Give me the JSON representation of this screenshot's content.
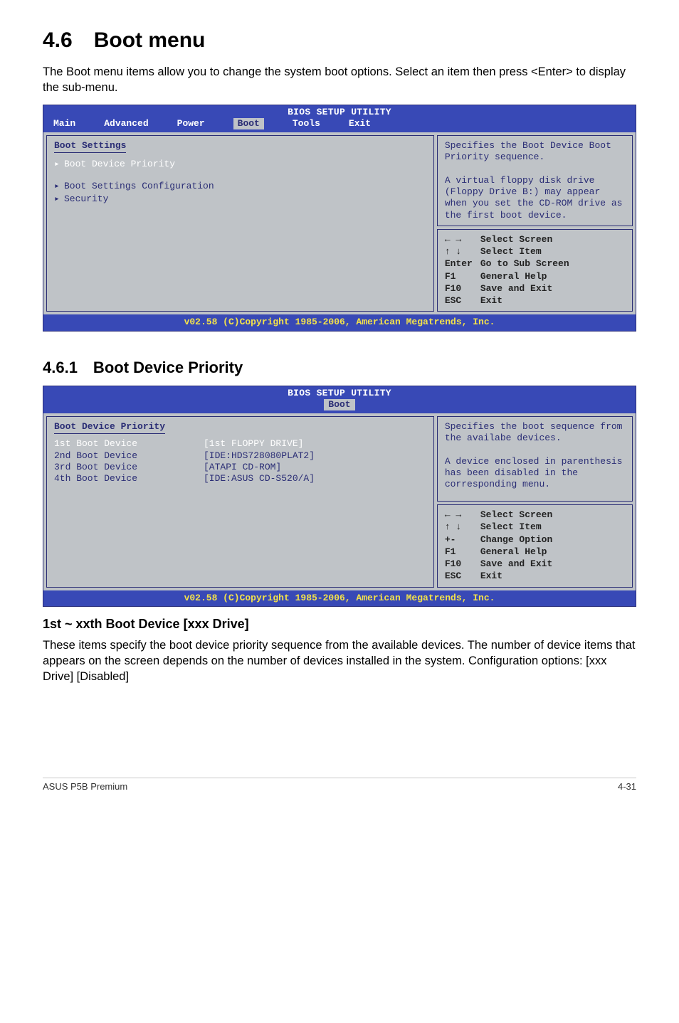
{
  "section": {
    "number_title": "4.6 Boot menu",
    "intro": "The Boot menu items allow you to change the system boot options. Select an item then press <Enter> to display the sub-menu."
  },
  "bios1": {
    "title": "BIOS SETUP UTILITY",
    "menus": {
      "m0": "Main",
      "m1": "Advanced",
      "m2": "Power",
      "m3": "Boot",
      "m4": "Tools",
      "m5": "Exit"
    },
    "left": {
      "heading": "Boot Settings",
      "items": {
        "i0": "Boot Device Priority",
        "i1": "Boot Settings Configuration",
        "i2": "Security"
      }
    },
    "help_top": "Specifies the Boot Device Boot Priority sequence.\n\nA virtual floppy disk drive (Floppy Drive B:) may appear when you set the CD-ROM drive as the first boot device.",
    "nav": {
      "l0": "Select Screen",
      "l1": "Select Item",
      "k2": "Enter",
      "l2": "Go to Sub Screen",
      "k3": "F1",
      "l3": "General Help",
      "k4": "F10",
      "l4": "Save and Exit",
      "k5": "ESC",
      "l5": "Exit"
    },
    "footer": "v02.58 (C)Copyright 1985-2006, American Megatrends, Inc."
  },
  "subsection": {
    "number_title": "4.6.1 Boot Device Priority"
  },
  "bios2": {
    "title": "BIOS SETUP UTILITY",
    "menu_active": "Boot",
    "left": {
      "heading": "Boot Device Priority",
      "rows": {
        "r0k": "1st Boot Device",
        "r0v": "[1st FLOPPY DRIVE]",
        "r1k": "2nd Boot Device",
        "r1v": "[IDE:HDS728080PLAT2]",
        "r2k": "3rd Boot Device",
        "r2v": "[ATAPI CD-ROM]",
        "r3k": "4th Boot Device",
        "r3v": "[IDE:ASUS CD-S520/A]"
      }
    },
    "help_top": "Specifies the boot sequence from the availabe devices.\n\nA device enclosed in parenthesis has been disabled in the corresponding menu.",
    "nav": {
      "l0": "Select Screen",
      "l1": "Select Item",
      "k2": "+-",
      "l2": "Change Option",
      "k3": "F1",
      "l3": "General Help",
      "k4": "F10",
      "l4": "Save and Exit",
      "k5": "ESC",
      "l5": "Exit"
    },
    "footer": "v02.58 (C)Copyright 1985-2006, American Megatrends, Inc."
  },
  "option": {
    "title": "1st ~ xxth Boot Device [xxx Drive]",
    "text": "These items specify the boot device priority sequence from the available devices. The number of device items that appears on the screen depends on the number of devices installed in the system. Configuration options: [xxx Drive] [Disabled]"
  },
  "footer": {
    "left": "ASUS P5B Premium",
    "right": "4-31"
  }
}
